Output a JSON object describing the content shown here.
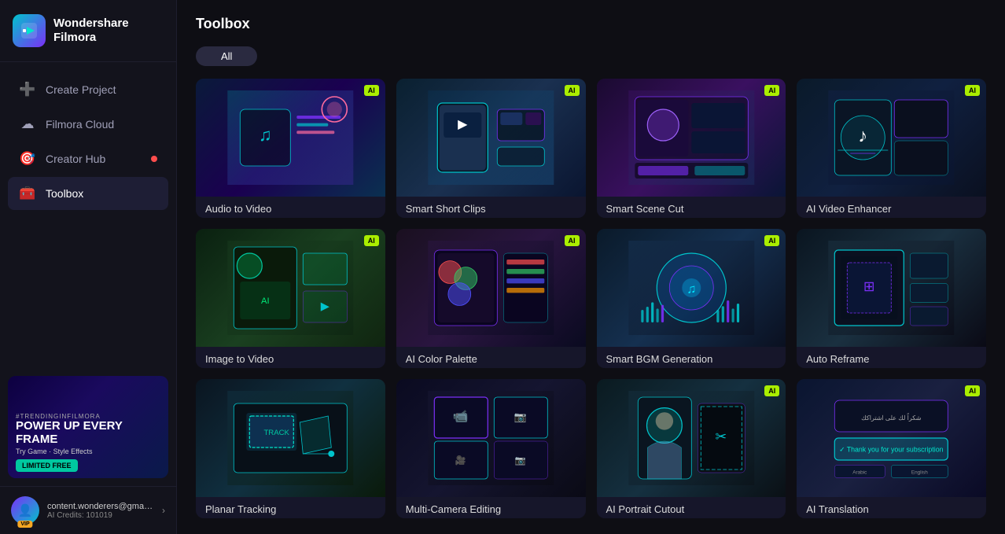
{
  "app": {
    "name": "Wondershare",
    "name2": "Filmora"
  },
  "sidebar": {
    "nav": [
      {
        "id": "create-project",
        "icon": "➕",
        "label": "Create Project",
        "active": false
      },
      {
        "id": "filmora-cloud",
        "icon": "☁",
        "label": "Filmora Cloud",
        "active": false
      },
      {
        "id": "creator-hub",
        "icon": "🎯",
        "label": "Creator Hub",
        "active": false,
        "dot": true
      },
      {
        "id": "toolbox",
        "icon": "🧰",
        "label": "Toolbox",
        "active": true
      }
    ],
    "banner": {
      "tag": "#TRENDINGINFILMORA",
      "title": "POWER UP EVERY FRAME",
      "sub": "Try Game · Style Effects",
      "btn": "LIMITED FREE"
    },
    "user": {
      "email": "content.wonderers@gmail....",
      "credits": "AI Credits: 101019",
      "vip": "VIP"
    }
  },
  "main": {
    "title": "Toolbox",
    "filter": "All",
    "tools": [
      {
        "id": "audio-to-video",
        "label": "Audio to Video",
        "ai": true,
        "theme": "audio"
      },
      {
        "id": "smart-short-clips",
        "label": "Smart Short Clips",
        "ai": true,
        "theme": "short"
      },
      {
        "id": "smart-scene-cut",
        "label": "Smart Scene Cut",
        "ai": true,
        "theme": "scene"
      },
      {
        "id": "ai-video-enhancer",
        "label": "AI Video Enhancer",
        "ai": true,
        "theme": "enhance"
      },
      {
        "id": "image-to-video",
        "label": "Image to Video",
        "ai": true,
        "theme": "image"
      },
      {
        "id": "ai-color-palette",
        "label": "AI Color Palette",
        "ai": true,
        "theme": "color"
      },
      {
        "id": "smart-bgm-generation",
        "label": "Smart BGM Generation",
        "ai": true,
        "theme": "bgm"
      },
      {
        "id": "auto-reframe",
        "label": "Auto Reframe",
        "ai": false,
        "theme": "reframe"
      },
      {
        "id": "planar-tracking",
        "label": "Planar Tracking",
        "ai": false,
        "theme": "planar"
      },
      {
        "id": "multi-camera-editing",
        "label": "Multi-Camera Editing",
        "ai": false,
        "theme": "multicam"
      },
      {
        "id": "ai-portrait-cutout",
        "label": "AI Portrait Cutout",
        "ai": true,
        "theme": "portrait"
      },
      {
        "id": "ai-translation",
        "label": "AI Translation",
        "ai": true,
        "theme": "translate"
      }
    ]
  }
}
